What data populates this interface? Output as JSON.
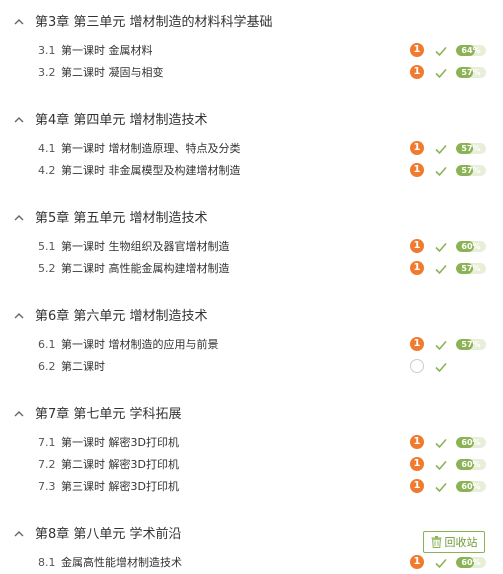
{
  "colors": {
    "badge": "#f07a2e",
    "check": "#8bb356",
    "progress_fill": "#8bb356",
    "progress_track": "#e7efd9",
    "text": "#333333"
  },
  "chapters": [
    {
      "title": "第3章 第三单元 增材制造的材料科学基础",
      "lessons": [
        {
          "num": "3.1",
          "title": "第一课时 金属材料",
          "badge": "1",
          "progress_label": "64%",
          "progress": 0.64
        },
        {
          "num": "3.2",
          "title": "第二课时 凝固与相变",
          "badge": "1",
          "progress_label": "57%",
          "progress": 0.57
        }
      ]
    },
    {
      "title": "第4章 第四单元 增材制造技术",
      "lessons": [
        {
          "num": "4.1",
          "title": "第一课时 增材制造原理、特点及分类",
          "badge": "1",
          "progress_label": "57%",
          "progress": 0.57
        },
        {
          "num": "4.2",
          "title": "第二课时 非金属模型及构建增材制造",
          "badge": "1",
          "progress_label": "57%",
          "progress": 0.57
        }
      ]
    },
    {
      "title": "第5章 第五单元 增材制造技术",
      "lessons": [
        {
          "num": "5.1",
          "title": "第一课时 生物组织及器官增材制造",
          "badge": "1",
          "progress_label": "60%",
          "progress": 0.6
        },
        {
          "num": "5.2",
          "title": "第二课时 高性能金属构建增材制造",
          "badge": "1",
          "progress_label": "57%",
          "progress": 0.57
        }
      ]
    },
    {
      "title": "第6章 第六单元 增材制造技术",
      "lessons": [
        {
          "num": "6.1",
          "title": "第一课时 增材制造的应用与前景",
          "badge": "1",
          "progress_label": "57%",
          "progress": 0.57
        },
        {
          "num": "6.2",
          "title": "第二课时",
          "badge": "",
          "progress_label": "",
          "progress": null
        }
      ]
    },
    {
      "title": "第7章 第七单元 学科拓展",
      "lessons": [
        {
          "num": "7.1",
          "title": "第一课时 解密3D打印机",
          "badge": "1",
          "progress_label": "60%",
          "progress": 0.6
        },
        {
          "num": "7.2",
          "title": "第二课时 解密3D打印机",
          "badge": "1",
          "progress_label": "60%",
          "progress": 0.6
        },
        {
          "num": "7.3",
          "title": "第三课时 解密3D打印机",
          "badge": "1",
          "progress_label": "60%",
          "progress": 0.6
        }
      ]
    },
    {
      "title": "第8章 第八单元 学术前沿",
      "lessons": [
        {
          "num": "8.1",
          "title": "金属高性能增材制造技术",
          "badge": "1",
          "progress_label": "60%",
          "progress": 0.6
        }
      ]
    }
  ],
  "recycle_label": "回收站",
  "icons": {
    "collapse": "chevron-up-icon",
    "done": "check-icon",
    "recycle": "trash-icon"
  }
}
